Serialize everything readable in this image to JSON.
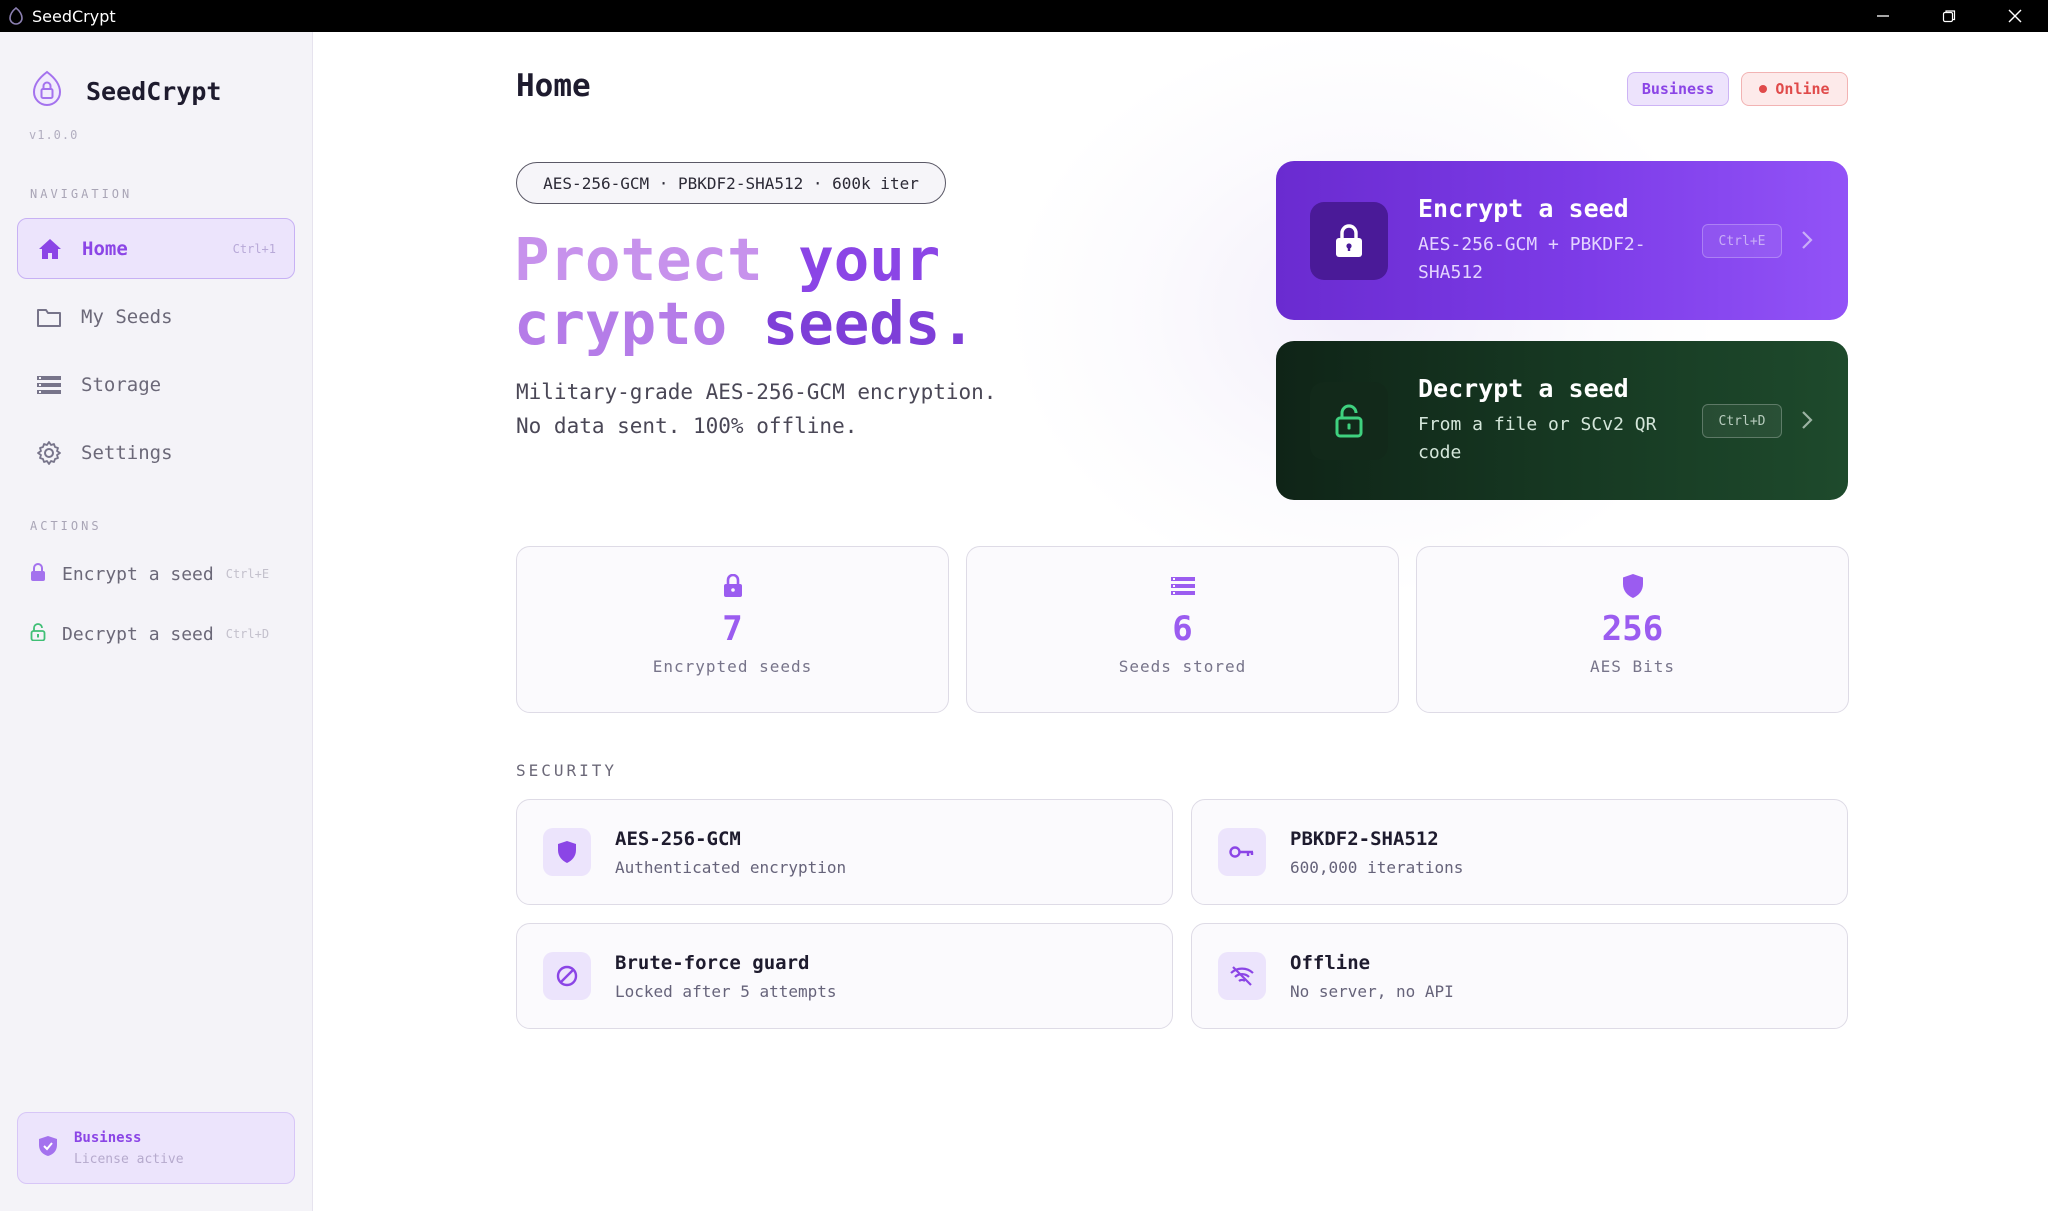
{
  "window": {
    "title": "SeedCrypt",
    "minimize_icon": "minimize-icon",
    "maximize_icon": "restore-icon",
    "close_icon": "close-icon"
  },
  "sidebar": {
    "brand": "SeedCrypt",
    "version": "v1.0.0",
    "nav_label": "NAVIGATION",
    "nav": [
      {
        "label": "Home",
        "shortcut": "Ctrl+1",
        "icon": "home-icon",
        "active": true
      },
      {
        "label": "My Seeds",
        "shortcut": "",
        "icon": "folder-icon",
        "active": false
      },
      {
        "label": "Storage",
        "shortcut": "",
        "icon": "storage-icon",
        "active": false
      },
      {
        "label": "Settings",
        "shortcut": "",
        "icon": "gear-icon",
        "active": false
      }
    ],
    "actions_label": "ACTIONS",
    "actions": [
      {
        "label": "Encrypt a seed",
        "shortcut": "Ctrl+E",
        "icon": "lock-icon"
      },
      {
        "label": "Decrypt a seed",
        "shortcut": "Ctrl+D",
        "icon": "unlock-icon"
      }
    ],
    "license": {
      "title": "Business",
      "subtitle": "License active",
      "icon": "shield-check-icon"
    }
  },
  "header": {
    "title": "Home",
    "badge_plan": "Business",
    "badge_status": "Online"
  },
  "hero": {
    "pill": "AES-256-GCM · PBKDF2-SHA512 · 600k iter",
    "line1_a": "Protect",
    "line1_b": "your",
    "line2_a": "crypto",
    "line2_b": "seeds.",
    "sub1": "Military-grade AES-256-GCM encryption.",
    "sub2": "No data sent. 100% offline."
  },
  "cta": {
    "encrypt": {
      "title": "Encrypt a seed",
      "subtitle": "AES-256-GCM + PBKDF2-SHA512",
      "shortcut": "Ctrl+E",
      "icon": "lock-icon"
    },
    "decrypt": {
      "title": "Decrypt a seed",
      "subtitle": "From a file or SCv2 QR code",
      "shortcut": "Ctrl+D",
      "icon": "unlock-icon"
    }
  },
  "stats": [
    {
      "value": "7",
      "label": "Encrypted seeds",
      "icon": "lock-icon"
    },
    {
      "value": "6",
      "label": "Seeds stored",
      "icon": "storage-icon"
    },
    {
      "value": "256",
      "label": "AES Bits",
      "icon": "shield-icon"
    }
  ],
  "security": {
    "label": "SECURITY",
    "items": [
      {
        "title": "AES-256-GCM",
        "subtitle": "Authenticated encryption",
        "icon": "shield-icon"
      },
      {
        "title": "PBKDF2-SHA512",
        "subtitle": "600,000 iterations",
        "icon": "key-icon"
      },
      {
        "title": "Brute-force guard",
        "subtitle": "Locked after 5 attempts",
        "icon": "block-icon"
      },
      {
        "title": "Offline",
        "subtitle": "No server, no API",
        "icon": "wifi-off-icon"
      }
    ]
  },
  "colors": {
    "accent": "#8b45e6",
    "encrypt_bg": "#7d3ce8",
    "decrypt_bg": "#173a23",
    "online": "#e04a4a"
  }
}
